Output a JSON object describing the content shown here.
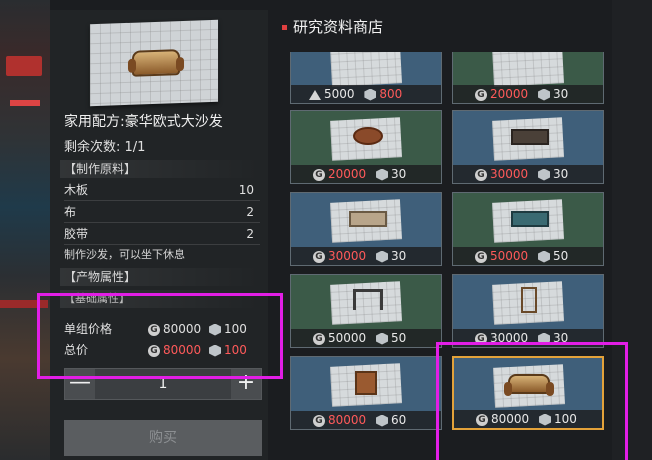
{
  "detail": {
    "recipe_name": "家用配方:豪华欧式大沙发",
    "remaining": "剩余次数: 1/1",
    "materials_header": "【制作原料】",
    "materials": [
      {
        "name": "木板",
        "qty": "10"
      },
      {
        "name": "布",
        "qty": "2"
      },
      {
        "name": "胶带",
        "qty": "2"
      }
    ],
    "description": "制作沙发，可以坐下休息",
    "properties_header": "【产物属性】",
    "base_attr_header": "【基础属性】",
    "unit_price_label": "单组价格",
    "unit_price_coin": "80000",
    "unit_price_cube": "100",
    "total_label": "总价",
    "total_coin": "80000",
    "total_cube": "100",
    "quantity": "1",
    "minus": "—",
    "plus": "+",
    "buy_label": "购买"
  },
  "shop": {
    "title": "研究资料商店",
    "items": [
      {
        "p1": "5000",
        "p2": "800",
        "p2_color": "#ff5a5a",
        "p1_icon": "tri",
        "bg": "blue"
      },
      {
        "p1": "20000",
        "p2": "30",
        "p1_color": "#ff5a5a",
        "bg": "green"
      },
      {
        "p1": "20000",
        "p2": "30",
        "p1_color": "#ff5a5a",
        "bg": "green"
      },
      {
        "p1": "30000",
        "p2": "30",
        "p1_color": "#ff5a5a",
        "bg": "blue"
      },
      {
        "p1": "30000",
        "p2": "30",
        "p1_color": "#ff5a5a",
        "bg": "blue"
      },
      {
        "p1": "50000",
        "p2": "50",
        "p1_color": "#ff5a5a",
        "bg": "green"
      },
      {
        "p1": "50000",
        "p2": "50",
        "bg": "green"
      },
      {
        "p1": "30000",
        "p2": "30",
        "bg": "blue"
      },
      {
        "p1": "80000",
        "p2": "60",
        "p1_color": "#ff5a5a",
        "bg": "blue"
      },
      {
        "p1": "80000",
        "p2": "100",
        "bg": "blue",
        "selected": true
      }
    ]
  }
}
